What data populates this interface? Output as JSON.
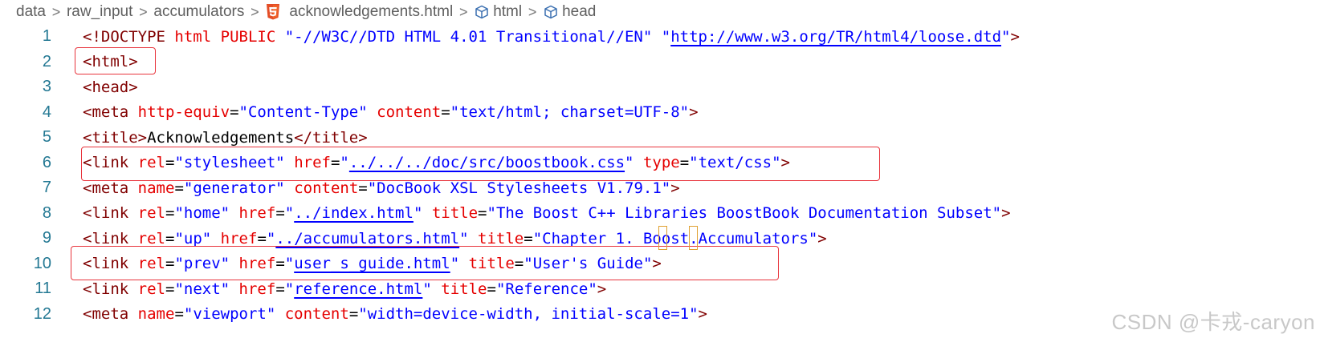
{
  "breadcrumb": {
    "items": [
      {
        "label": "data"
      },
      {
        "label": "raw_input"
      },
      {
        "label": "accumulators"
      },
      {
        "label": "acknowledgements.html",
        "icon": "html5-icon"
      },
      {
        "label": "html",
        "icon": "cube-icon"
      },
      {
        "label": "head",
        "icon": "cube-icon"
      }
    ],
    "separator": ">"
  },
  "colors": {
    "tag": "#800000",
    "attribute": "#e50000",
    "string": "#0000ff",
    "line_number": "#237893",
    "annotation_box": "#e8343c"
  },
  "lines": [
    {
      "n": "1",
      "text": "<!DOCTYPE html PUBLIC \"-//W3C//DTD HTML 4.01 Transitional//EN\" \"http://www.w3.org/TR/html4/loose.dtd\">"
    },
    {
      "n": "2",
      "text": "<html>"
    },
    {
      "n": "3",
      "text": "<head>"
    },
    {
      "n": "4",
      "text": "<meta http-equiv=\"Content-Type\" content=\"text/html; charset=UTF-8\">"
    },
    {
      "n": "5",
      "text": "<title>Acknowledgements</title>"
    },
    {
      "n": "6",
      "text": "<link rel=\"stylesheet\" href=\"../../../doc/src/boostbook.css\" type=\"text/css\">"
    },
    {
      "n": "7",
      "text": "<meta name=\"generator\" content=\"DocBook XSL Stylesheets V1.79.1\">"
    },
    {
      "n": "8",
      "text": "<link rel=\"home\" href=\"../index.html\" title=\"The Boost C++ Libraries BoostBook Documentation Subset\">"
    },
    {
      "n": "9",
      "text": "<link rel=\"up\" href=\"../accumulators.html\" title=\"Chapter 1. Boost.Accumulators\">"
    },
    {
      "n": "10",
      "text": "<link rel=\"prev\" href=\"user_s_guide.html\" title=\"User's Guide\">"
    },
    {
      "n": "11",
      "text": "<link rel=\"next\" href=\"reference.html\" title=\"Reference\">"
    },
    {
      "n": "12",
      "text": "<meta name=\"viewport\" content=\"width=device-width, initial-scale=1\">"
    }
  ],
  "tokens": {
    "l1": {
      "open": "<!",
      "doctype": "DOCTYPE",
      "html": "html",
      "public": "PUBLIC",
      "s1": "\"-//W3C//DTD HTML 4.01 Transitional//EN\"",
      "q_open": "\"",
      "url": "http://www.w3.org/TR/html4/loose.dtd",
      "q_close": "\"",
      "close": ">"
    },
    "l2": {
      "open": "<",
      "tag": "html",
      "close": ">"
    },
    "l3": {
      "open": "<",
      "tag": "head",
      "close": ">"
    },
    "l4": {
      "open": "<",
      "tag": "meta",
      "a1": "http-equiv",
      "v1": "\"Content-Type\"",
      "a2": "content",
      "v2": "\"text/html; charset=UTF-8\"",
      "close": ">"
    },
    "l5": {
      "open": "<",
      "tag": "title",
      "close": ">",
      "text": "Acknowledgements",
      "open2": "</",
      "tag2": "title",
      "close2": ">"
    },
    "l6": {
      "open": "<",
      "tag": "link",
      "a1": "rel",
      "v1": "\"stylesheet\"",
      "a2": "href",
      "q": "\"",
      "url": "../../../doc/src/boostbook.css",
      "a3": "type",
      "v3": "\"text/css\"",
      "close": ">"
    },
    "l7": {
      "open": "<",
      "tag": "meta",
      "a1": "name",
      "v1": "\"generator\"",
      "a2": "content",
      "v2": "\"DocBook XSL Stylesheets V1.79.1\"",
      "close": ">"
    },
    "l8": {
      "open": "<",
      "tag": "link",
      "a1": "rel",
      "v1": "\"home\"",
      "a2": "href",
      "q": "\"",
      "url": "../index.html",
      "a3": "title",
      "v3": "\"The Boost C++ Libraries BoostBook Documentation Subset\"",
      "close": ">"
    },
    "l9": {
      "open": "<",
      "tag": "link",
      "a1": "rel",
      "v1": "\"up\"",
      "a2": "href",
      "q": "\"",
      "url": "../accumulators.html",
      "a3": "title",
      "v3": "\"Chapter 1. Boost.Accumulators\"",
      "close": ">"
    },
    "l10": {
      "open": "<",
      "tag": "link",
      "a1": "rel",
      "v1": "\"prev\"",
      "a2": "href",
      "q": "\"",
      "url": "user_s_guide.html",
      "a3": "title",
      "v3": "\"User's Guide\"",
      "close": ">"
    },
    "l11": {
      "open": "<",
      "tag": "link",
      "a1": "rel",
      "v1": "\"next\"",
      "a2": "href",
      "q": "\"",
      "url": "reference.html",
      "a3": "title",
      "v3": "\"Reference\"",
      "close": ">"
    },
    "l12": {
      "open": "<",
      "tag": "meta",
      "a1": "name",
      "v1": "\"viewport\"",
      "a2": "content",
      "v2": "\"width=device-width, initial-scale=1\"",
      "close": ">"
    }
  },
  "watermark": "CSDN @卡戎-caryon"
}
